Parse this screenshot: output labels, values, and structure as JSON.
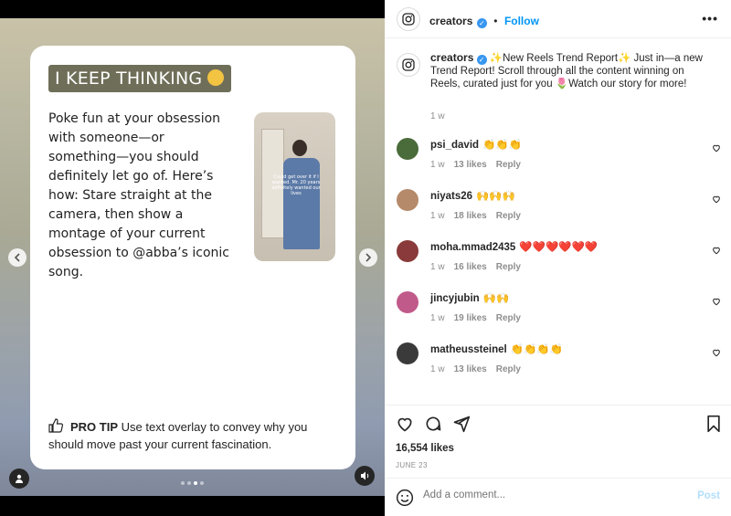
{
  "story": {
    "tag_text": "I KEEP THINKING",
    "body": "Poke fun at your obsession with someone—or something—you should definitely let go of. Here’s how: Stare straight at the camera, then show a montage of your current obsession to @abba’s iconic song.",
    "thumb_caption": "Could get over it if I wanted. Mr. 20 years definitely wanted our lives",
    "protip_label": "PRO TIP",
    "protip_text": "Use text overlay to convey why you should move past your current fascination.",
    "prev_icon": "chevron-left-icon",
    "next_icon": "chevron-right-icon",
    "dots_count": 4,
    "active_dot": 2
  },
  "header": {
    "username": "creators",
    "separator": "•",
    "follow": "Follow",
    "more_icon": "more-horizontal-icon"
  },
  "caption": {
    "username": "creators",
    "text": "✨New Reels Trend Report✨ Just in—a new Trend Report! Scroll through all the content winning on Reels, curated just for you 🌷Watch our story for more!",
    "time": "1 w"
  },
  "comments": [
    {
      "user": "psi_david",
      "text": "👏👏👏",
      "time": "1 w",
      "likes": "13 likes",
      "reply": "Reply",
      "avatar_color": "#4a6b3a"
    },
    {
      "user": "niyats26",
      "text": "🙌🙌🙌",
      "time": "1 w",
      "likes": "18 likes",
      "reply": "Reply",
      "avatar_color": "#b58a6a"
    },
    {
      "user": "moha.mmad2435",
      "text": "❤️❤️❤️❤️❤️❤️",
      "time": "1 w",
      "likes": "16 likes",
      "reply": "Reply",
      "avatar_color": "#8a3a3a"
    },
    {
      "user": "jincyjubin",
      "text": "🙌🙌",
      "time": "1 w",
      "likes": "19 likes",
      "reply": "Reply",
      "avatar_color": "#c05a8a"
    },
    {
      "user": "matheussteinel",
      "text": "👏👏👏👏",
      "time": "1 w",
      "likes": "13 likes",
      "reply": "Reply",
      "avatar_color": "#3a3a3a"
    }
  ],
  "actions": {
    "likes": "16,554 likes",
    "date": "JUNE 23"
  },
  "add_comment": {
    "placeholder": "Add a comment...",
    "post": "Post"
  }
}
